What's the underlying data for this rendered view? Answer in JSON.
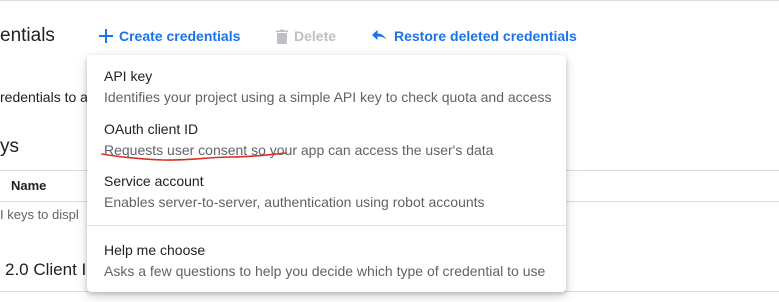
{
  "page": {
    "title": "entials"
  },
  "toolbar": {
    "create_label": "Create credentials",
    "delete_label": "Delete",
    "restore_label": "Restore deleted credentials"
  },
  "background": {
    "intro_text": "redentials to a",
    "section1_title": "ys",
    "table_header_name": "Name",
    "empty_text": "I keys to displ",
    "section2_title": "2.0 Client I"
  },
  "dropdown": {
    "items": [
      {
        "title": "API key",
        "description": "Identifies your project using a simple API key to check quota and access"
      },
      {
        "title": "OAuth client ID",
        "description": "Requests user consent so your app can access the user's data"
      },
      {
        "title": "Service account",
        "description": "Enables server-to-server, authentication using robot accounts"
      },
      {
        "title": "Help me choose",
        "description": "Asks a few questions to help you decide which type of credential to use"
      }
    ]
  },
  "icons": {
    "create": "plus-icon",
    "delete": "trash-icon",
    "restore": "undo-icon"
  },
  "colors": {
    "accent": "#1a73e8",
    "disabled": "#bdc1c6",
    "annotation": "#d93025"
  }
}
